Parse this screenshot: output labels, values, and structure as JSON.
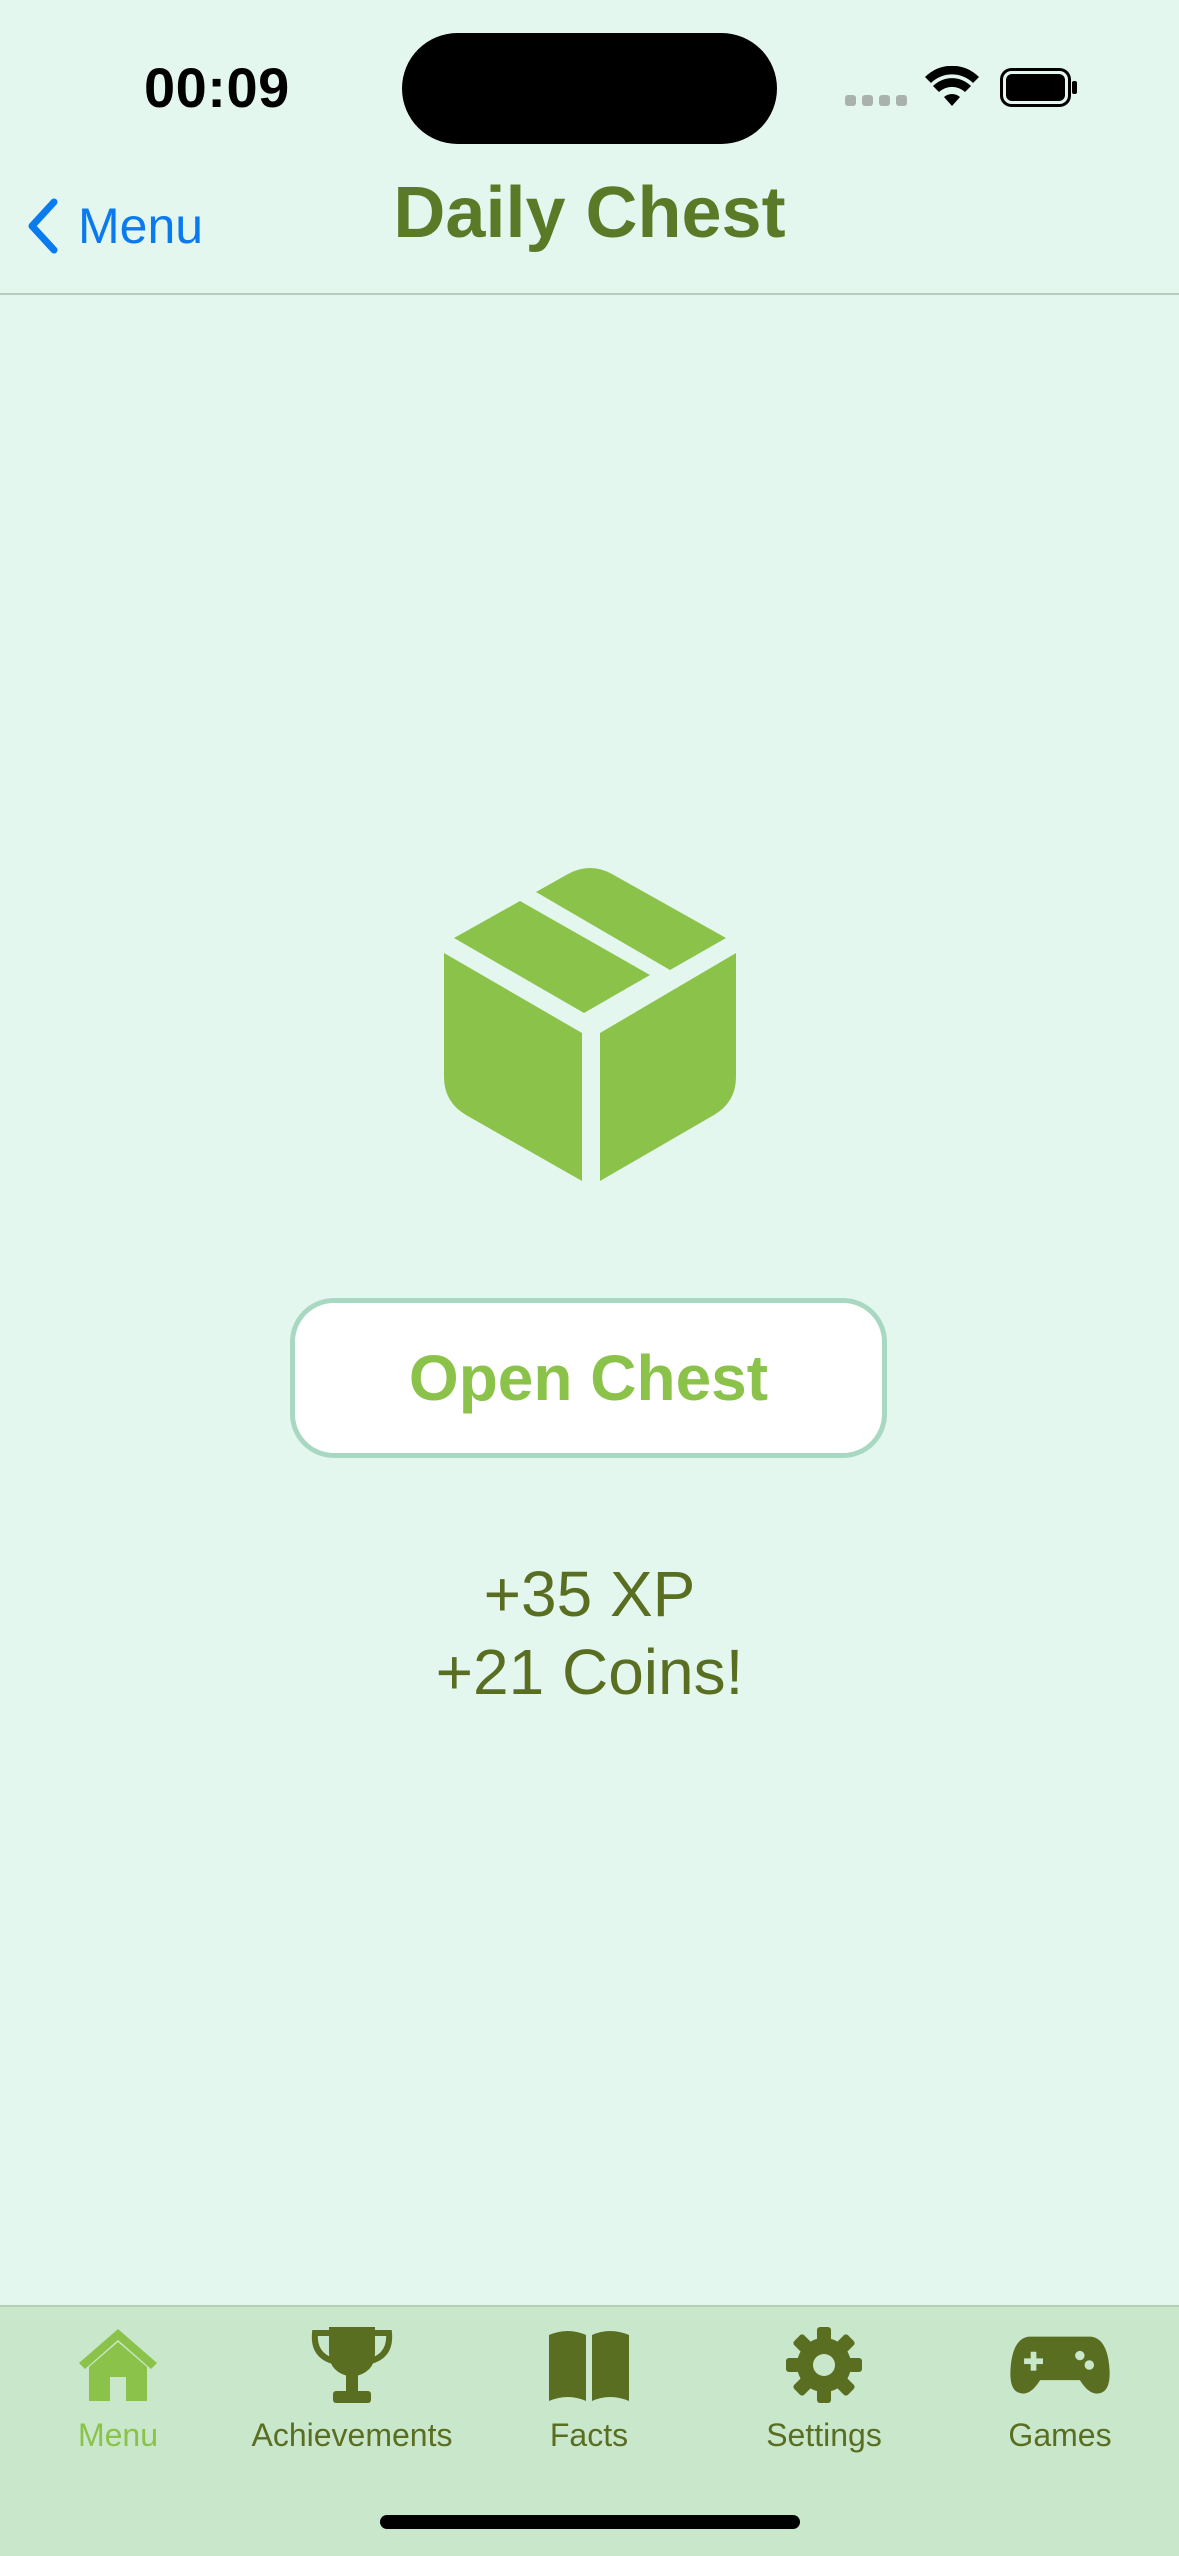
{
  "status_bar": {
    "time": "00:09",
    "icons": [
      "signal-icon",
      "wifi-icon",
      "battery-icon"
    ]
  },
  "nav": {
    "back_label": "Menu",
    "title": "Daily Chest"
  },
  "chest": {
    "icon": "shipping-box-icon",
    "color": "#8bc34a"
  },
  "actions": {
    "open_label": "Open Chest"
  },
  "reward": {
    "xp_text": "+35 XP",
    "coins_text": "+21 Coins!"
  },
  "tabbar": {
    "active_color": "#8bc34a",
    "inactive_color": "#5a6e22",
    "items": [
      {
        "label": "Menu",
        "icon": "house-icon",
        "active": true
      },
      {
        "label": "Achievements",
        "icon": "trophy-icon",
        "active": false
      },
      {
        "label": "Facts",
        "icon": "book-icon",
        "active": false
      },
      {
        "label": "Settings",
        "icon": "gear-icon",
        "active": false
      },
      {
        "label": "Games",
        "icon": "gamecontroller-icon",
        "active": false
      }
    ]
  }
}
